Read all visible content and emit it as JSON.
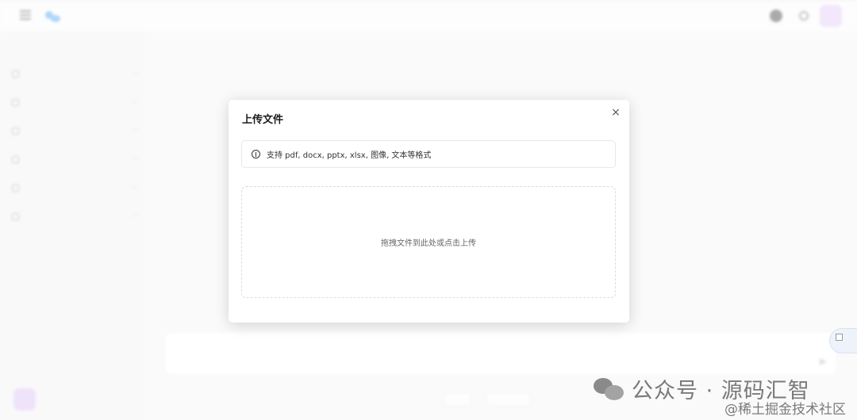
{
  "modal": {
    "title": "上传文件",
    "close_glyph": "×",
    "info_text": "支持 pdf, docx, pptx, xlsx, 图像, 文本等格式",
    "dropzone_text": "拖拽文件到此处或点击上传"
  },
  "icons": {
    "info": "info-circle-icon",
    "close": "close-icon",
    "menu": "menu-icon",
    "wechat": "wechat-icon"
  },
  "watermark": {
    "badge": "公众号 · 源码汇智",
    "juejin": "@稀土掘金技术社区"
  },
  "colors": {
    "avatar": "#e5c9f5",
    "logo": "#4fa6ee"
  }
}
